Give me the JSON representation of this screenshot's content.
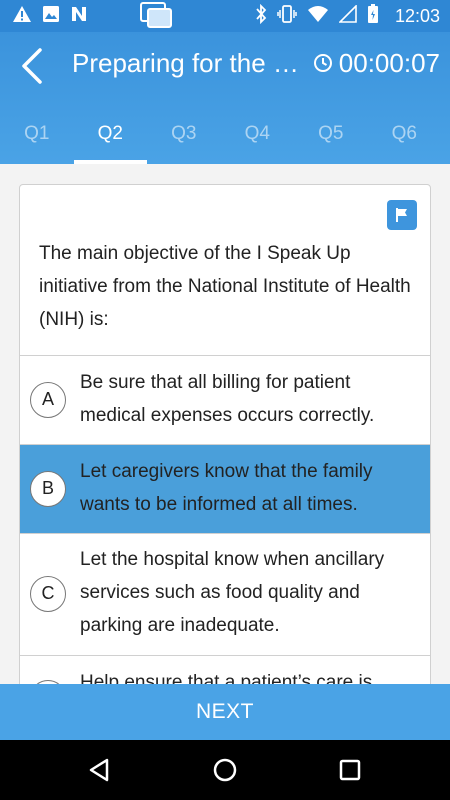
{
  "status_bar": {
    "time": "12:03",
    "left_icons": [
      "warning-icon",
      "image-icon",
      "n-icon"
    ],
    "right_icons": [
      "bluetooth-icon",
      "vibrate-icon",
      "wifi-icon",
      "signal-icon",
      "battery-icon"
    ]
  },
  "app_bar": {
    "title": "Preparing for the P...",
    "timer": "00:00:07",
    "tabs": [
      {
        "label": "Q1",
        "active": false
      },
      {
        "label": "Q2",
        "active": true
      },
      {
        "label": "Q3",
        "active": false
      },
      {
        "label": "Q4",
        "active": false
      },
      {
        "label": "Q5",
        "active": false
      },
      {
        "label": "Q6",
        "active": false
      }
    ]
  },
  "question": {
    "text": "The main objective of the I Speak Up initiative from the National Institute of Health (NIH) is:",
    "options": [
      {
        "letter": "A",
        "text": "Be sure that all billing for patient medical expenses occurs correctly.",
        "selected": false
      },
      {
        "letter": "B",
        "text": "Let caregivers know that the family wants to be informed at all times.",
        "selected": true
      },
      {
        "letter": "C",
        "text": "Let the hospital know when ancillary services such as food quality and parking are inadequate.",
        "selected": false
      },
      {
        "letter": "D",
        "text": "Help ensure that a patient’s care is",
        "selected": false
      }
    ]
  },
  "next_label": "NEXT",
  "colors": {
    "primary": "#3b93dc",
    "selected_option": "#4a9fda"
  }
}
